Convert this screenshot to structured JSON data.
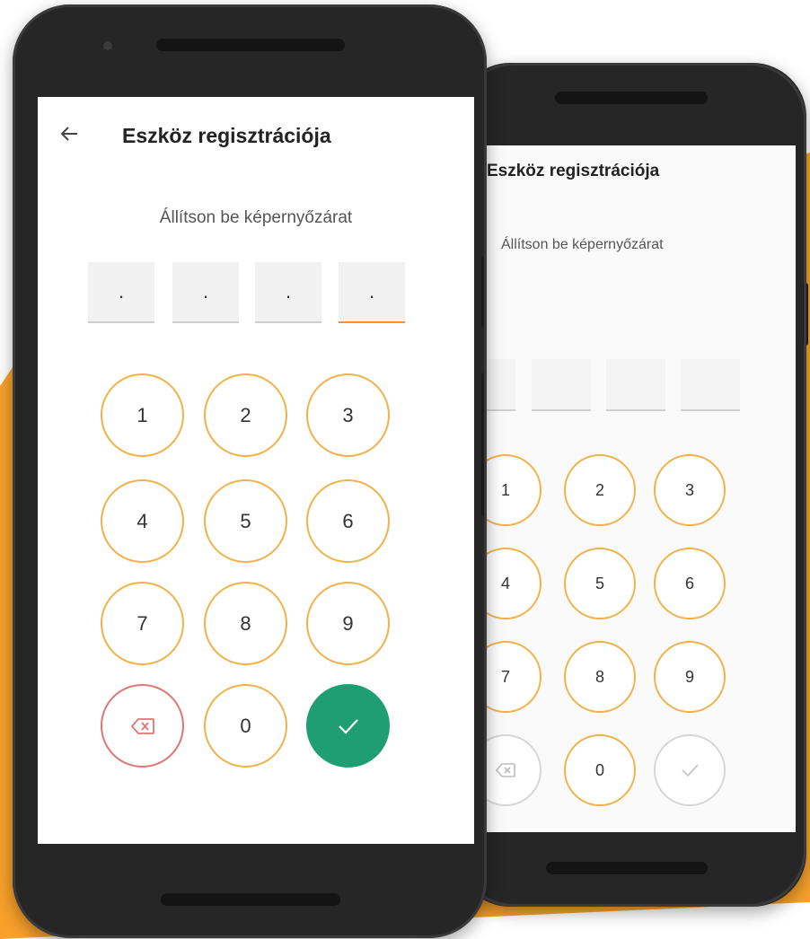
{
  "colors": {
    "accent_orange": "#f7a02b",
    "key_outline": "#f0b24a",
    "delete_outline": "#e07575",
    "confirm_green": "#1f9e74",
    "phone_body": "#262626"
  },
  "front_phone": {
    "back_icon": "arrow-left-icon",
    "title": "Eszköz regisztrációja",
    "subtitle": "Állítson be képernyőzárat",
    "pin_slots": [
      ".",
      ".",
      ".",
      "."
    ],
    "active_slot_index": 3,
    "keys": [
      "1",
      "2",
      "3",
      "4",
      "5",
      "6",
      "7",
      "8",
      "9"
    ],
    "zero_key": "0",
    "delete_icon": "backspace-icon",
    "confirm_icon": "checkmark-icon"
  },
  "back_phone": {
    "title": "Eszköz regisztrációja",
    "subtitle": "Állítson be képernyőzárat",
    "pin_slots": [
      "",
      "",
      "",
      ""
    ],
    "keys": [
      "1",
      "2",
      "3",
      "4",
      "5",
      "6",
      "7",
      "8",
      "9"
    ],
    "zero_key": "0",
    "delete_icon": "backspace-icon",
    "confirm_icon": "checkmark-icon"
  }
}
